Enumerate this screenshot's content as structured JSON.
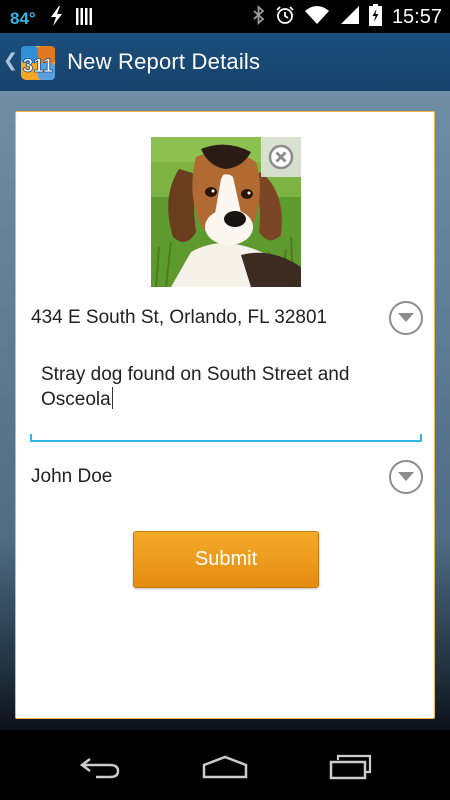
{
  "status_bar": {
    "temperature": "84°",
    "time": "15:57",
    "icons": [
      "lightning-icon",
      "signal-bars-icon",
      "bluetooth-icon",
      "alarm-icon",
      "wifi-icon",
      "cell-signal-icon",
      "battery-charging-icon"
    ]
  },
  "action_bar": {
    "app_logo_text": "311",
    "title": "New Report Details"
  },
  "form": {
    "photo_alt": "Photo of a beagle puppy on grass",
    "address": "434 E South St, Orlando, FL 32801",
    "description": "Stray dog found on South Street and Osceola",
    "reporter_name": "John Doe",
    "submit_label": "Submit"
  },
  "colors": {
    "action_bar": "#1c4f7d",
    "accent_blue": "#33b5e5",
    "submit_orange": "#ee9a1e",
    "card_border": "#f0b64a"
  },
  "nav_bar": {
    "icons": [
      "back-icon",
      "home-icon",
      "recent-apps-icon"
    ]
  }
}
